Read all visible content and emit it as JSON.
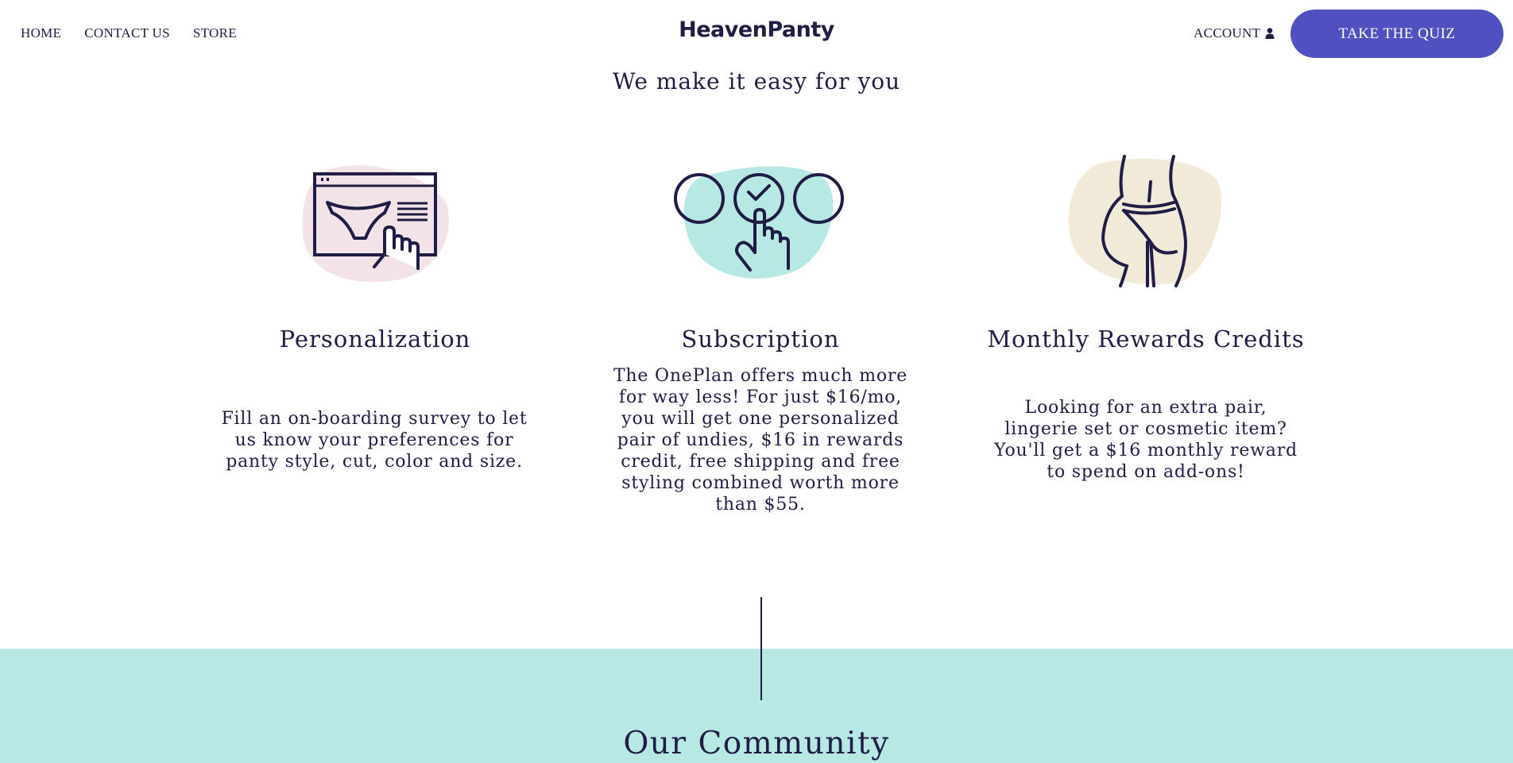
{
  "nav": {
    "home": "HOME",
    "contact": "CONTACT US",
    "store": "STORE"
  },
  "brand": {
    "name": "HeavenPanty"
  },
  "account": {
    "label": "ACCOUNT",
    "icon": "user-icon"
  },
  "cta": {
    "label": "TAKE THE QUIZ"
  },
  "tagline": "We make it easy for you",
  "features": [
    {
      "title": "Personalization",
      "text": "Fill an on-boarding survey to let us know your preferences for panty style, cut, color and size.",
      "icon": "browser-panty-click-icon",
      "blob_color": "#f3e2e7"
    },
    {
      "title": "Subscription",
      "text": "The OnePlan offers much more for way less! For just $16/mo, you will get one personalized pair of undies, $16 in rewards credit, free shipping and free styling combined worth more than $55.",
      "icon": "select-option-click-icon",
      "blob_color": "#b8e8e4"
    },
    {
      "title": "Monthly Rewards Credits",
      "text": "Looking for an extra pair, lingerie set or cosmetic item? You'll get a $16 monthly reward to spend on add-ons!",
      "icon": "body-lingerie-icon",
      "blob_color": "#f2ead8"
    }
  ],
  "community": {
    "title": "Our Community"
  },
  "colors": {
    "text": "#1f1d45",
    "accent": "#5050c0",
    "community_bg": "#b8e8e4"
  }
}
